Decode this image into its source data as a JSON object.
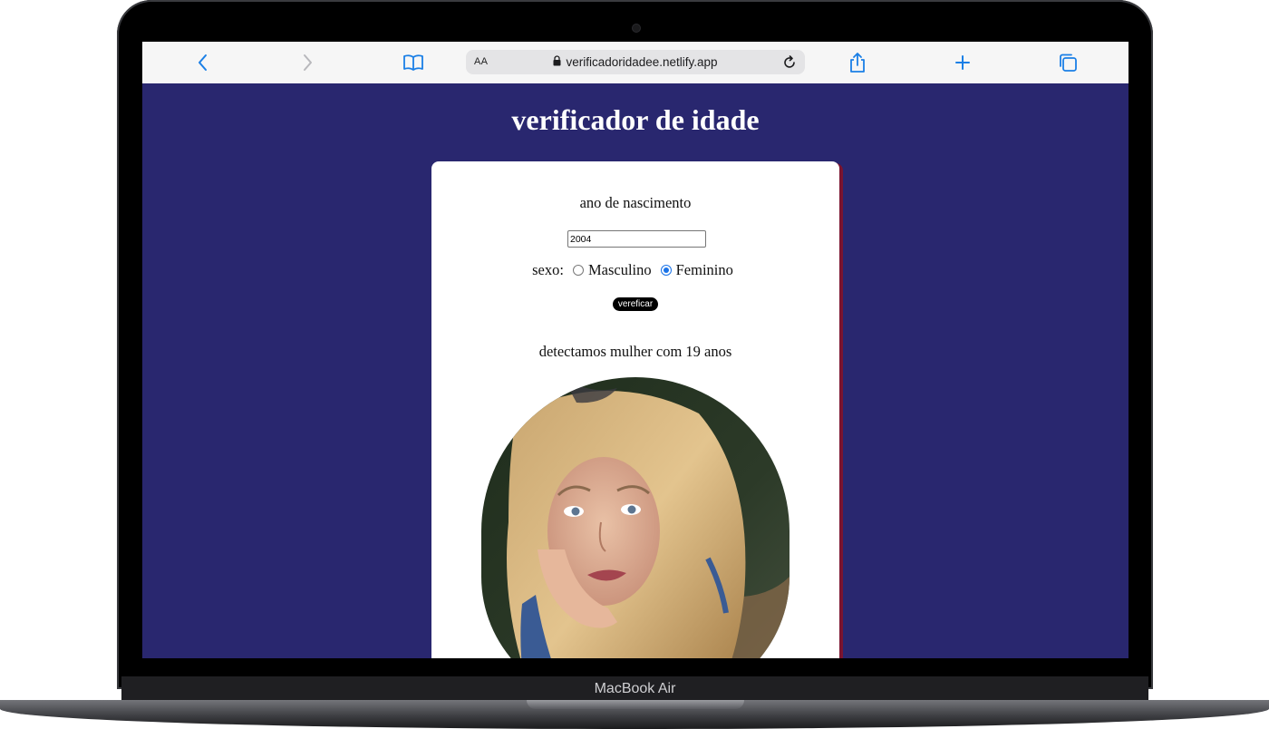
{
  "device": {
    "label": "MacBook Air"
  },
  "browser": {
    "text_size_label": "AA",
    "url": "verificadoridadee.netlify.app",
    "icons": {
      "back": "chevron-left-icon",
      "forward": "chevron-right-icon",
      "bookmarks": "book-icon",
      "lock": "lock-icon",
      "reload": "reload-icon",
      "share": "share-icon",
      "new_tab": "plus-icon",
      "tabs": "tabs-icon"
    },
    "accent_color": "#1a7fe6"
  },
  "page": {
    "title": "verificador de idade",
    "background_color": "#29276f",
    "form": {
      "year_label": "ano de nascimento",
      "year_value": "2004",
      "sex_label": "sexo:",
      "options": [
        {
          "label": "Masculino",
          "checked": false
        },
        {
          "label": "Feminino",
          "checked": true
        }
      ],
      "verify_label": "vereficar"
    },
    "result_text": "detectamos mulher com 19 anos",
    "photo": {
      "subject": "portrait-photo"
    }
  }
}
